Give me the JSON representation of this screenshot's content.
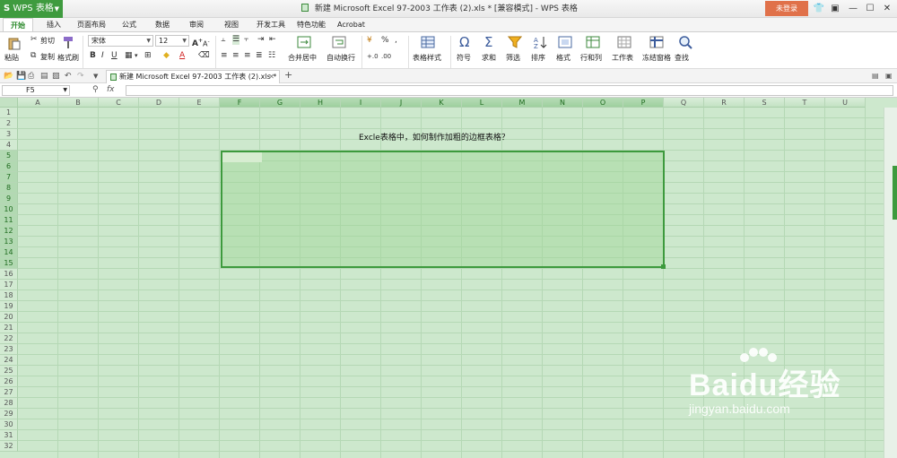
{
  "app": {
    "button_label": "WPS 表格",
    "window_title": "新建 Microsoft Excel 97-2003 工作表 (2).xls * [兼容模式] - WPS 表格",
    "login_label": "未登录"
  },
  "menu": [
    "开始",
    "插入",
    "页面布局",
    "公式",
    "数据",
    "审阅",
    "视图",
    "开发工具",
    "特色功能",
    "Acrobat"
  ],
  "ribbon": {
    "paste": "粘贴",
    "cut": "剪切",
    "copy": "复制",
    "format_painter": "格式刷",
    "font_name": "宋体",
    "font_size": "12",
    "merge_center": "合并居中",
    "wrap_text": "自动换行",
    "table_style": "表格样式",
    "symbol": "符号",
    "sum": "求和",
    "filter": "筛选",
    "sort": "排序",
    "format": "格式",
    "row_col": "行和列",
    "worksheet": "工作表",
    "freeze": "冻结窗格",
    "find": "查找"
  },
  "file_tab": {
    "label": "新建 Microsoft Excel 97-2003 工作表 (2).xls *"
  },
  "formula_bar": {
    "name_box": "F5",
    "fx": "fx",
    "value": ""
  },
  "columns": [
    "A",
    "B",
    "C",
    "D",
    "E",
    "F",
    "G",
    "H",
    "I",
    "J",
    "K",
    "L",
    "M",
    "N",
    "O",
    "P",
    "Q",
    "R",
    "S",
    "T",
    "U"
  ],
  "selected_columns": [
    "F",
    "G",
    "H",
    "I",
    "J",
    "K",
    "L",
    "M",
    "N",
    "O",
    "P"
  ],
  "rows": [
    "1",
    "2",
    "3",
    "4",
    "5",
    "6",
    "7",
    "8",
    "9",
    "10",
    "11",
    "12",
    "13",
    "14",
    "15",
    "16",
    "17",
    "18",
    "19",
    "20",
    "21",
    "22",
    "23",
    "24",
    "25",
    "26",
    "27",
    "28",
    "29",
    "30",
    "31",
    "32"
  ],
  "selected_rows": [
    "5",
    "6",
    "7",
    "8",
    "9",
    "10",
    "11",
    "12",
    "13",
    "14",
    "15"
  ],
  "sheet": {
    "title_cell": "Excle表格中，如何制作加粗的边框表格？",
    "active_cell": "F5",
    "selection": "F5:P15"
  },
  "watermark": {
    "logo": "Baidu经验",
    "url": "jingyan.baidu.com"
  },
  "colors": {
    "app_green": "#3f9b3f",
    "login_orange": "#e0714a",
    "grid_bg": "#cde8cd",
    "selection_border": "#3d9a3d"
  }
}
